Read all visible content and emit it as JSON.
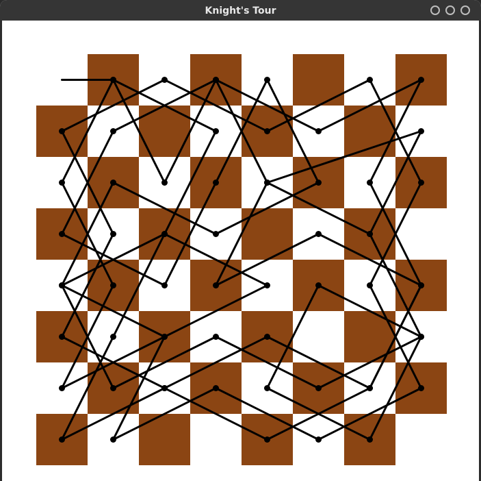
{
  "window": {
    "title": "Knight's Tour",
    "controls": [
      "minimize-icon",
      "maximize-icon",
      "close-icon"
    ]
  },
  "board": {
    "size": 8,
    "dark_color": "#8b4513",
    "light_color": "#ffffff",
    "path_color": "#000000",
    "tour_start": {
      "col": 0,
      "row": 0
    }
  },
  "tour": [
    [
      1,
      0
    ],
    [
      3,
      1
    ],
    [
      2,
      3
    ],
    [
      1,
      5
    ],
    [
      0,
      7
    ],
    [
      2,
      6
    ],
    [
      4,
      7
    ],
    [
      6,
      6
    ],
    [
      7,
      4
    ],
    [
      5,
      3
    ],
    [
      3,
      4
    ],
    [
      4,
      2
    ],
    [
      6,
      3
    ],
    [
      7,
      5
    ],
    [
      5,
      4
    ],
    [
      4,
      6
    ],
    [
      6,
      7
    ],
    [
      7,
      5
    ],
    [
      5,
      6
    ],
    [
      3,
      5
    ],
    [
      1,
      6
    ],
    [
      0,
      4
    ],
    [
      2,
      3
    ],
    [
      4,
      4
    ],
    [
      2,
      5
    ],
    [
      0,
      6
    ],
    [
      1,
      4
    ],
    [
      0,
      2
    ],
    [
      1,
      0
    ],
    [
      2,
      2
    ],
    [
      3,
      0
    ],
    [
      5,
      1
    ],
    [
      7,
      0
    ],
    [
      6,
      2
    ],
    [
      7,
      4
    ],
    [
      6,
      6
    ],
    [
      4,
      5
    ],
    [
      2,
      6
    ],
    [
      0,
      5
    ],
    [
      1,
      3
    ],
    [
      0,
      1
    ],
    [
      2,
      0
    ],
    [
      4,
      1
    ],
    [
      6,
      0
    ],
    [
      7,
      2
    ],
    [
      6,
      4
    ],
    [
      7,
      6
    ],
    [
      5,
      7
    ],
    [
      3,
      6
    ],
    [
      1,
      7
    ],
    [
      2,
      5
    ],
    [
      0,
      4
    ],
    [
      1,
      2
    ],
    [
      3,
      3
    ],
    [
      5,
      2
    ],
    [
      4,
      0
    ],
    [
      3,
      2
    ],
    [
      2,
      4
    ],
    [
      0,
      3
    ],
    [
      1,
      1
    ],
    [
      3,
      0
    ],
    [
      4,
      2
    ],
    [
      7,
      1
    ],
    [
      6,
      3
    ]
  ]
}
